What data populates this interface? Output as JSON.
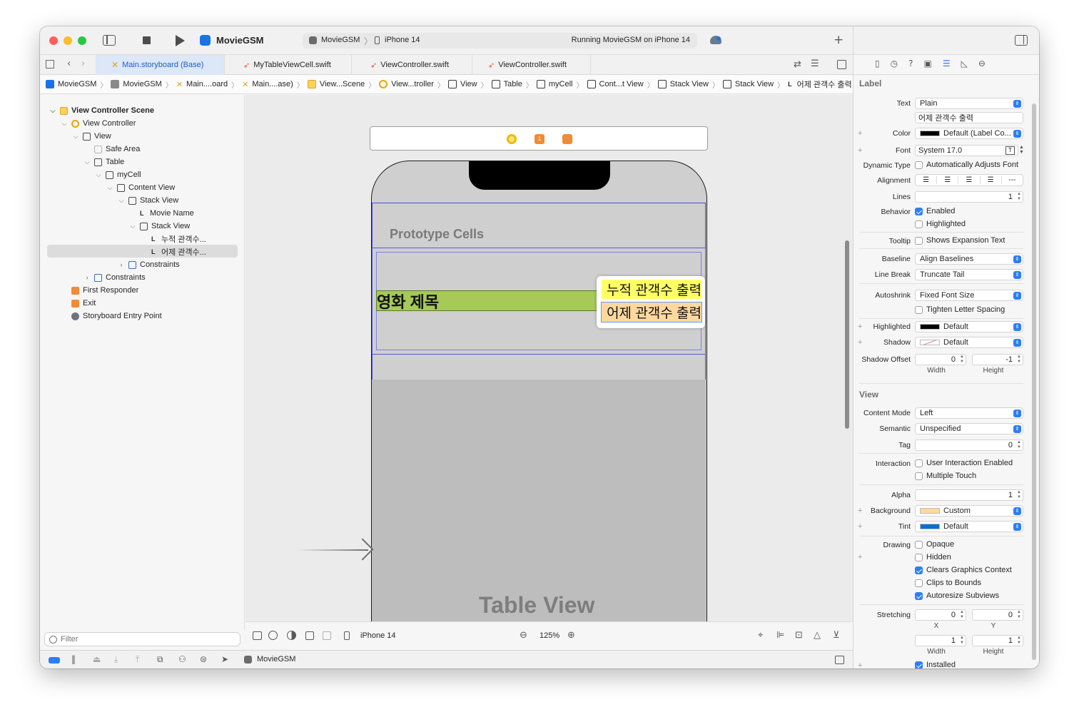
{
  "toolbar": {
    "project_name": "MovieGSM",
    "scheme": "MovieGSM",
    "device": "iPhone 14",
    "status": "Running MovieGSM on iPhone 14"
  },
  "tabs": [
    {
      "label": "Main.storyboard (Base)",
      "active": true
    },
    {
      "label": "MyTableViewCell.swift",
      "active": false
    },
    {
      "label": "ViewController.swift",
      "active": false
    },
    {
      "label": "ViewController.swift",
      "active": false
    }
  ],
  "breadcrumb": [
    "MovieGSM",
    "MovieGSM",
    "Main....oard",
    "Main....ase)",
    "View...Scene",
    "View...troller",
    "View",
    "Table",
    "myCell",
    "Cont...t View",
    "Stack View",
    "Stack View",
    "어제 관객수 출력"
  ],
  "outline": {
    "scene": "View Controller Scene",
    "view_controller": "View Controller",
    "view": "View",
    "safe_area": "Safe Area",
    "table": "Table",
    "cell": "myCell",
    "content_view": "Content View",
    "stack_view_1": "Stack View",
    "movie_name": "Movie Name",
    "stack_view_2": "Stack View",
    "label_cumulative": "누적 관객수...",
    "label_yesterday": "어제 관객수...",
    "constraints_inner": "Constraints",
    "constraints_outer": "Constraints",
    "first_responder": "First Responder",
    "exit": "Exit",
    "entry_point": "Storyboard Entry Point",
    "filter_placeholder": "Filter"
  },
  "canvas": {
    "prototype_cells": "Prototype Cells",
    "movie_title": "영화 제목",
    "cumulative_label": "누적 관객수 출력",
    "yesterday_label": "어제 관객수 출력",
    "table_view": "Table View"
  },
  "bottom_bar": {
    "device": "iPhone 14",
    "zoom": "125%"
  },
  "debug_bar": {
    "target": "MovieGSM"
  },
  "inspector": {
    "label_header": "Label",
    "text_label": "Text",
    "text_type": "Plain",
    "text_value": "어제 관객수 출력",
    "color_label": "Color",
    "color_value": "Default (Label Co...",
    "font_label": "Font",
    "font_value": "System 17.0",
    "dynamic_type_label": "Dynamic Type",
    "dynamic_type_value": "Automatically Adjusts Font",
    "alignment_label": "Alignment",
    "lines_label": "Lines",
    "lines_value": "1",
    "behavior_label": "Behavior",
    "enabled_label": "Enabled",
    "highlighted_label": "Highlighted",
    "tooltip_label": "Tooltip",
    "tooltip_value": "Shows Expansion Text",
    "baseline_label": "Baseline",
    "baseline_value": "Align Baselines",
    "line_break_label": "Line Break",
    "line_break_value": "Truncate Tail",
    "autoshrink_label": "Autoshrink",
    "autoshrink_value": "Fixed Font Size",
    "tighten_label": "Tighten Letter Spacing",
    "highlighted_color_label": "Highlighted",
    "highlighted_color_value": "Default",
    "shadow_label": "Shadow",
    "shadow_value": "Default",
    "shadow_offset_label": "Shadow Offset",
    "shadow_offset_width": "0",
    "shadow_offset_height": "-1",
    "width_label": "Width",
    "height_label": "Height",
    "view_header": "View",
    "content_mode_label": "Content Mode",
    "content_mode_value": "Left",
    "semantic_label": "Semantic",
    "semantic_value": "Unspecified",
    "tag_label": "Tag",
    "tag_value": "0",
    "interaction_label": "Interaction",
    "user_interaction_label": "User Interaction Enabled",
    "multiple_touch_label": "Multiple Touch",
    "alpha_label": "Alpha",
    "alpha_value": "1",
    "background_label": "Background",
    "background_value": "Custom",
    "tint_label": "Tint",
    "tint_value": "Default",
    "drawing_label": "Drawing",
    "opaque_label": "Opaque",
    "hidden_label": "Hidden",
    "clears_label": "Clears Graphics Context",
    "clips_label": "Clips to Bounds",
    "autoresize_label": "Autoresize Subviews",
    "stretching_label": "Stretching",
    "stretch_x": "0",
    "stretch_y": "0",
    "x_label": "X",
    "y_label": "Y",
    "stretch_w": "1",
    "stretch_h": "1",
    "installed_label": "Installed"
  },
  "colors": {
    "accent": "#2c7ef8",
    "movie_label_bg": "#a7c957",
    "cumulative_label_bg": "#ffff66",
    "yesterday_label_bg": "#ffd8a0",
    "tint": "#0a6ed1"
  }
}
